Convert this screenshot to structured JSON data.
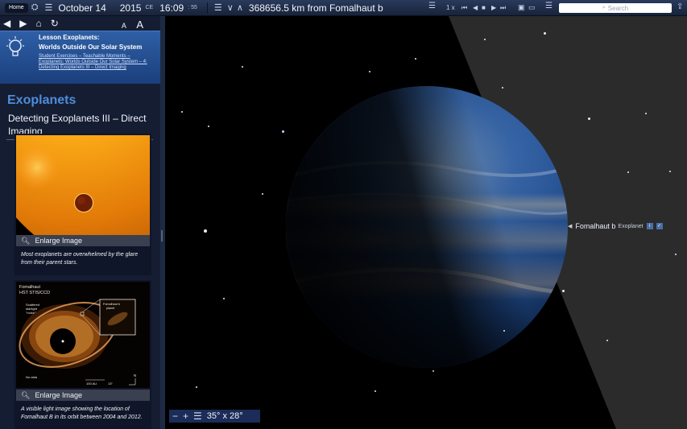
{
  "topbar": {
    "home_label": "Home",
    "date": "October 14",
    "year": "2015",
    "era": "CE",
    "time": "16:09",
    "seconds": ": 55",
    "distance_text": "368656.5 km from Fomalhaut b",
    "speed": "1 x",
    "search_placeholder": "Search"
  },
  "sidebar": {
    "lesson_title_line1": "Lesson Exoplanets:",
    "lesson_title_line2": "Worlds Outside Our Solar System",
    "lesson_breadcrumb_1": "Student Exercises – Teachable Moments –",
    "lesson_breadcrumb_2": "Exoplanets: Worlds Outside Our Solar System – 4:",
    "lesson_breadcrumb_3": "Detecting Exoplanets III – Direct Imaging",
    "section_title": "Exoplanets",
    "page_title": "Detecting Exoplanets III – Direct Imaging",
    "cards": [
      {
        "enlarge_label": "Enlarge Image",
        "caption": "Most exoplanets are overwhelmed by the glare from their parent stars."
      },
      {
        "enlarge_label": "Enlarge Image",
        "caption": "A visible light image showing the location of Fomalhaut B in its orbit between 2004 and 2012.",
        "image_labels": {
          "title1": "Fomalhaut",
          "title2": "HST STIS/CCD",
          "scattered1": "Scattered",
          "scattered2": "starlight",
          "scattered3": "\"noise\"",
          "inset1": "Fomalhaut b",
          "inset2": "planet",
          "nodata": "No data",
          "scale": "100 AU",
          "scale2": "13\""
        }
      }
    ],
    "font_small": "A",
    "font_large": "A"
  },
  "space": {
    "planet_name": "Fomalhaut b",
    "planet_type": "Exoplanet",
    "fov": "35° x 28°"
  },
  "colors": {
    "accent": "#4e8ddb",
    "lesson_bg": "#2e5fa6",
    "sidebar_bg": "#151d33"
  }
}
